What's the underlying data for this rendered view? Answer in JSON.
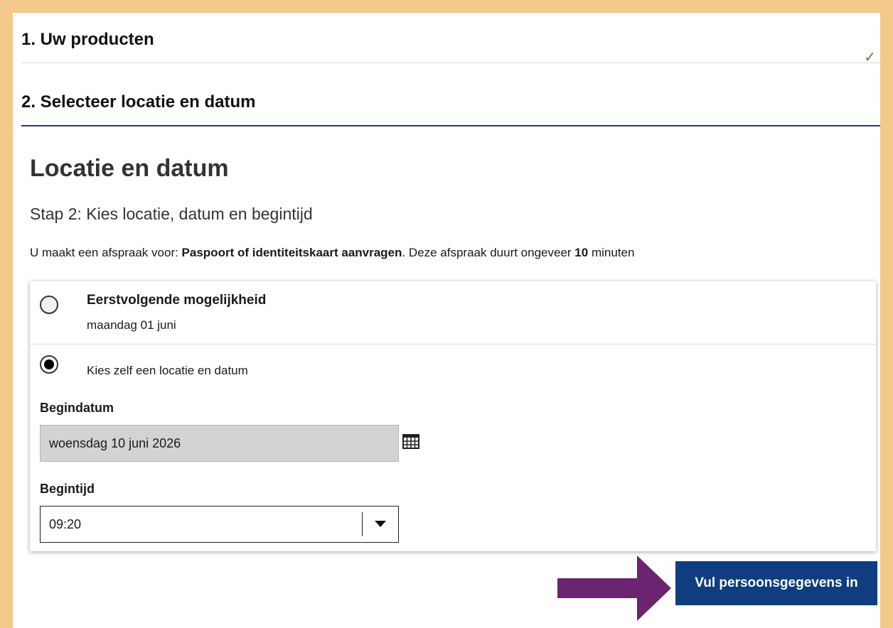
{
  "steps": [
    {
      "label": "1. Uw producten",
      "completed": true
    },
    {
      "label": "2. Selecteer locatie en datum",
      "completed": false
    }
  ],
  "page": {
    "title": "Locatie en datum",
    "subtitle": "Stap 2: Kies locatie, datum en begintijd",
    "info_prefix": "U maakt een afspraak voor: ",
    "info_product": "Paspoort of identiteitskaart aanvragen",
    "info_mid": ". Deze afspraak duurt ongeveer ",
    "info_duration": "10",
    "info_suffix": " minuten"
  },
  "options": {
    "first": {
      "title": "Eerstvolgende mogelijkheid",
      "date": "maandag 01 juni",
      "selected": false
    },
    "custom": {
      "label": "Kies zelf een locatie en datum",
      "selected": true
    }
  },
  "form": {
    "begindatum_label": "Begindatum",
    "begindatum_value": "woensdag 10 juni 2026",
    "begintijd_label": "Begintijd",
    "begintijd_value": "09:20"
  },
  "actions": {
    "next_label": "Vul persoonsgegevens in"
  },
  "colors": {
    "accent": "#0f3d7f",
    "annotation_arrow": "#6b2470",
    "frame": "#f5c88c"
  }
}
